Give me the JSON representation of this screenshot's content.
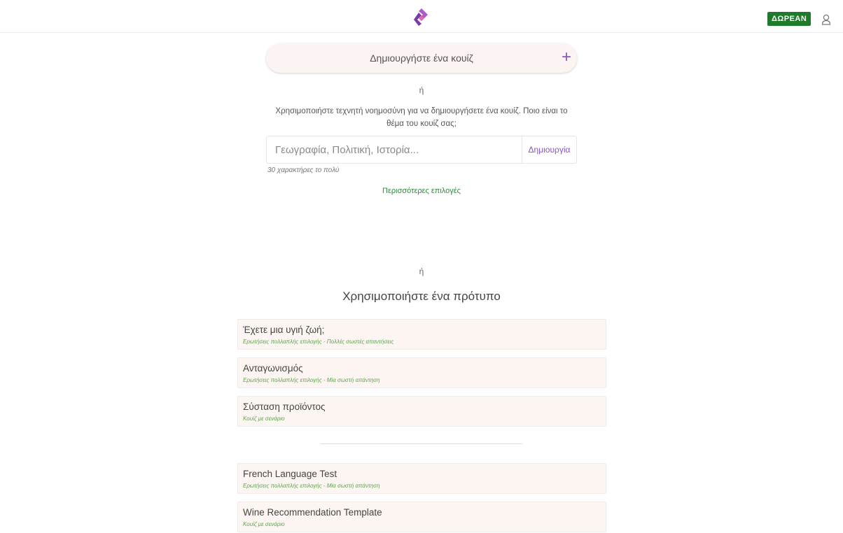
{
  "header": {
    "free_badge": "ΔΩΡΕΑΝ",
    "logo_icon": "brand-logo-icon",
    "user_icon": "user-icon",
    "accent_color": "#8a54c9",
    "badge_color": "#1f7a2b"
  },
  "create": {
    "label": "Δημιουργήστε ένα κουίζ",
    "plus": "+"
  },
  "or_text": "ή",
  "ai": {
    "description": "Χρησιμοποιήστε τεχνητή νοημοσύνη για να δημιουργήσετε ένα κουίζ. Ποιο είναι το θέμα του κουίζ σας;",
    "placeholder": "Γεωγραφία, Πολιτική, Ιστορία...",
    "button": "Δημιουργία",
    "char_hint": "30 χαρακτήρες το πολύ",
    "more_options": "Περισσότερες επιλογές"
  },
  "templates": {
    "title": "Χρησιμοποιήστε ένα πρότυπο",
    "group1": [
      {
        "name": "Έχετε μια υγιή ζωή;",
        "type": "Ερωτήσεις πολλαπλής επιλογής - Πολλές σωστές απαντήσεις"
      },
      {
        "name": "Ανταγωνισμός",
        "type": "Ερωτήσεις πολλαπλής επιλογής - Μία σωστή απάντηση"
      },
      {
        "name": "Σύσταση προϊόντος",
        "type": "Κουίζ με σενάριο"
      }
    ],
    "group2": [
      {
        "name": "French Language Test",
        "type": "Ερωτήσεις πολλαπλής επιλογής - Μία σωστή απάντηση"
      },
      {
        "name": "Wine Recommendation Template",
        "type": "Κουίζ με σενάριο"
      }
    ]
  }
}
